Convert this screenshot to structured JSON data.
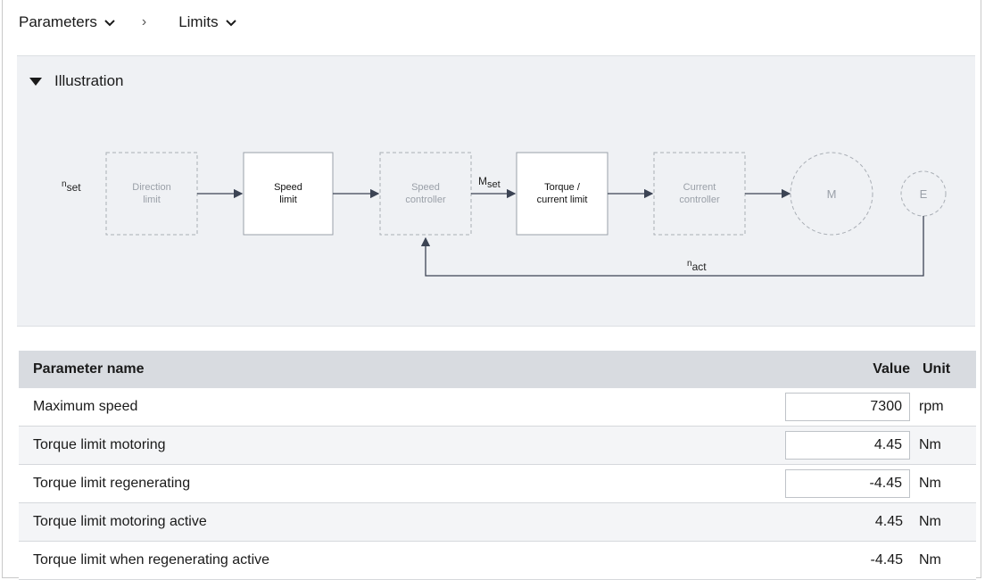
{
  "breadcrumb": {
    "item1": "Parameters",
    "separator": "›",
    "item2": "Limits"
  },
  "illustration": {
    "heading": "Illustration",
    "blocks": {
      "direction_limit": [
        "Direction",
        "limit"
      ],
      "speed_limit": [
        "Speed",
        "limit"
      ],
      "speed_controller": [
        "Speed",
        "controller"
      ],
      "torque_current_limit": [
        "Torque /",
        "current limit"
      ],
      "current_controller": [
        "Current",
        "controller"
      ],
      "motor": "M",
      "encoder": "E"
    },
    "signals": {
      "n_set": {
        "base": "n",
        "sub": "set"
      },
      "m_set": {
        "base": "M",
        "sub": "set"
      },
      "n_act": {
        "base": "n",
        "sub": "act"
      }
    }
  },
  "table": {
    "headers": {
      "name": "Parameter name",
      "value": "Value",
      "unit": "Unit"
    },
    "rows": [
      {
        "name": "Maximum speed",
        "value": "7300",
        "unit": "rpm",
        "editable": true
      },
      {
        "name": "Torque limit motoring",
        "value": "4.45",
        "unit": "Nm",
        "editable": true
      },
      {
        "name": "Torque limit regenerating",
        "value": "-4.45",
        "unit": "Nm",
        "editable": true
      },
      {
        "name": "Torque limit motoring active",
        "value": "4.45",
        "unit": "Nm",
        "editable": false
      },
      {
        "name": "Torque limit when regenerating active",
        "value": "-4.45",
        "unit": "Nm",
        "editable": false
      }
    ]
  },
  "colors": {
    "panel_bg": "#eff1f4",
    "header_bg": "#d8dbe0",
    "arrow": "#4a5568",
    "dashed": "#a9aeb5"
  }
}
